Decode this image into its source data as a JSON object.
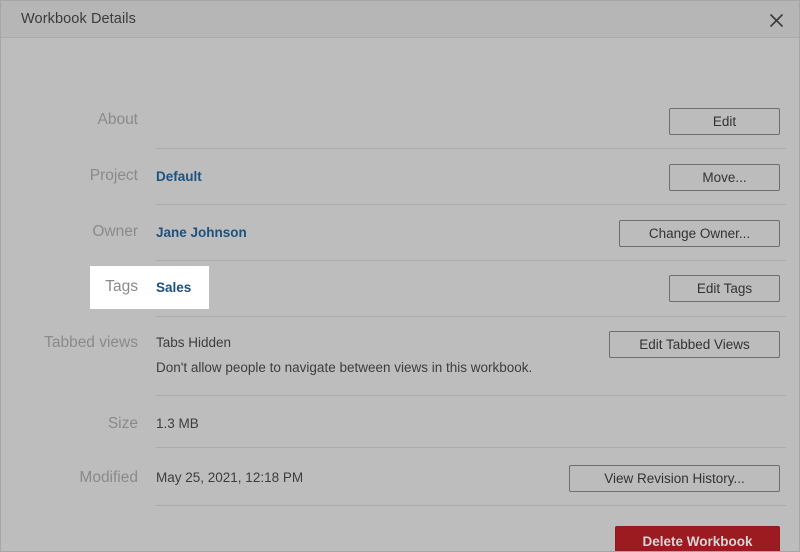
{
  "window": {
    "title": "Workbook Details",
    "close_icon": "close-icon"
  },
  "rows": [
    {
      "label": "About",
      "value": "",
      "button": "Edit"
    },
    {
      "label": "Project",
      "value": "Default",
      "button": "Move..."
    },
    {
      "label": "Owner",
      "value": "Jane Johnson",
      "button": "Change Owner..."
    },
    {
      "label": "Tags",
      "value": "Sales",
      "button": "Edit Tags"
    },
    {
      "label": "Tabbed views",
      "value": "Tabs Hidden",
      "sub": "Don't allow people to navigate between views in this workbook.",
      "button": "Edit Tabbed Views"
    },
    {
      "label": "Size",
      "value": "1.3 MB",
      "button": ""
    },
    {
      "label": "Modified",
      "value": "May 25, 2021, 12:18 PM",
      "button": "View Revision History..."
    }
  ],
  "footer": {
    "delete_label": "Delete Workbook"
  },
  "colors": {
    "link": "#1c5280",
    "danger": "#9b1b20",
    "label": "#8a8a8a",
    "background": "#bdbdbd",
    "titlebar": "#b6b6b6",
    "divider": "#aaaaaa",
    "highlight": "#ffffff"
  }
}
